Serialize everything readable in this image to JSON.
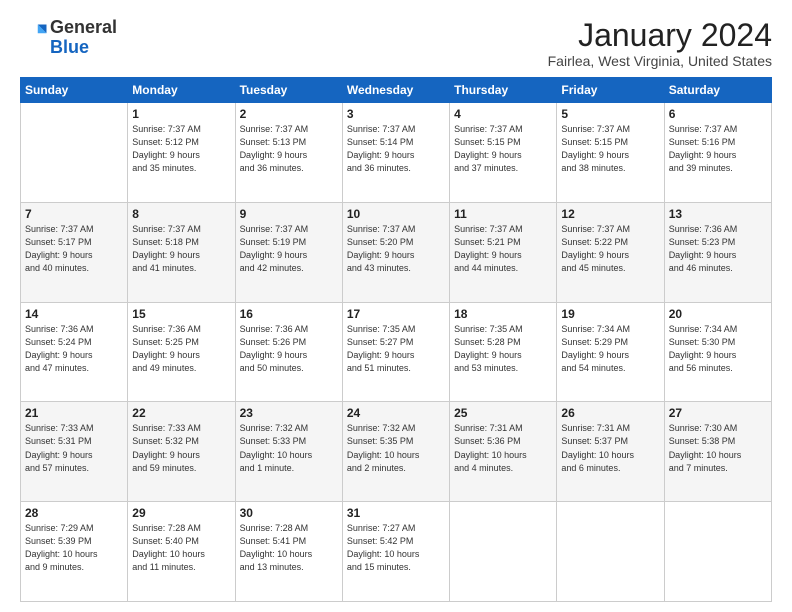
{
  "header": {
    "logo_general": "General",
    "logo_blue": "Blue",
    "month_title": "January 2024",
    "location": "Fairlea, West Virginia, United States"
  },
  "days_of_week": [
    "Sunday",
    "Monday",
    "Tuesday",
    "Wednesday",
    "Thursday",
    "Friday",
    "Saturday"
  ],
  "weeks": [
    [
      {
        "day": "",
        "info": ""
      },
      {
        "day": "1",
        "info": "Sunrise: 7:37 AM\nSunset: 5:12 PM\nDaylight: 9 hours\nand 35 minutes."
      },
      {
        "day": "2",
        "info": "Sunrise: 7:37 AM\nSunset: 5:13 PM\nDaylight: 9 hours\nand 36 minutes."
      },
      {
        "day": "3",
        "info": "Sunrise: 7:37 AM\nSunset: 5:14 PM\nDaylight: 9 hours\nand 36 minutes."
      },
      {
        "day": "4",
        "info": "Sunrise: 7:37 AM\nSunset: 5:15 PM\nDaylight: 9 hours\nand 37 minutes."
      },
      {
        "day": "5",
        "info": "Sunrise: 7:37 AM\nSunset: 5:15 PM\nDaylight: 9 hours\nand 38 minutes."
      },
      {
        "day": "6",
        "info": "Sunrise: 7:37 AM\nSunset: 5:16 PM\nDaylight: 9 hours\nand 39 minutes."
      }
    ],
    [
      {
        "day": "7",
        "info": "Sunrise: 7:37 AM\nSunset: 5:17 PM\nDaylight: 9 hours\nand 40 minutes."
      },
      {
        "day": "8",
        "info": "Sunrise: 7:37 AM\nSunset: 5:18 PM\nDaylight: 9 hours\nand 41 minutes."
      },
      {
        "day": "9",
        "info": "Sunrise: 7:37 AM\nSunset: 5:19 PM\nDaylight: 9 hours\nand 42 minutes."
      },
      {
        "day": "10",
        "info": "Sunrise: 7:37 AM\nSunset: 5:20 PM\nDaylight: 9 hours\nand 43 minutes."
      },
      {
        "day": "11",
        "info": "Sunrise: 7:37 AM\nSunset: 5:21 PM\nDaylight: 9 hours\nand 44 minutes."
      },
      {
        "day": "12",
        "info": "Sunrise: 7:37 AM\nSunset: 5:22 PM\nDaylight: 9 hours\nand 45 minutes."
      },
      {
        "day": "13",
        "info": "Sunrise: 7:36 AM\nSunset: 5:23 PM\nDaylight: 9 hours\nand 46 minutes."
      }
    ],
    [
      {
        "day": "14",
        "info": "Sunrise: 7:36 AM\nSunset: 5:24 PM\nDaylight: 9 hours\nand 47 minutes."
      },
      {
        "day": "15",
        "info": "Sunrise: 7:36 AM\nSunset: 5:25 PM\nDaylight: 9 hours\nand 49 minutes."
      },
      {
        "day": "16",
        "info": "Sunrise: 7:36 AM\nSunset: 5:26 PM\nDaylight: 9 hours\nand 50 minutes."
      },
      {
        "day": "17",
        "info": "Sunrise: 7:35 AM\nSunset: 5:27 PM\nDaylight: 9 hours\nand 51 minutes."
      },
      {
        "day": "18",
        "info": "Sunrise: 7:35 AM\nSunset: 5:28 PM\nDaylight: 9 hours\nand 53 minutes."
      },
      {
        "day": "19",
        "info": "Sunrise: 7:34 AM\nSunset: 5:29 PM\nDaylight: 9 hours\nand 54 minutes."
      },
      {
        "day": "20",
        "info": "Sunrise: 7:34 AM\nSunset: 5:30 PM\nDaylight: 9 hours\nand 56 minutes."
      }
    ],
    [
      {
        "day": "21",
        "info": "Sunrise: 7:33 AM\nSunset: 5:31 PM\nDaylight: 9 hours\nand 57 minutes."
      },
      {
        "day": "22",
        "info": "Sunrise: 7:33 AM\nSunset: 5:32 PM\nDaylight: 9 hours\nand 59 minutes."
      },
      {
        "day": "23",
        "info": "Sunrise: 7:32 AM\nSunset: 5:33 PM\nDaylight: 10 hours\nand 1 minute."
      },
      {
        "day": "24",
        "info": "Sunrise: 7:32 AM\nSunset: 5:35 PM\nDaylight: 10 hours\nand 2 minutes."
      },
      {
        "day": "25",
        "info": "Sunrise: 7:31 AM\nSunset: 5:36 PM\nDaylight: 10 hours\nand 4 minutes."
      },
      {
        "day": "26",
        "info": "Sunrise: 7:31 AM\nSunset: 5:37 PM\nDaylight: 10 hours\nand 6 minutes."
      },
      {
        "day": "27",
        "info": "Sunrise: 7:30 AM\nSunset: 5:38 PM\nDaylight: 10 hours\nand 7 minutes."
      }
    ],
    [
      {
        "day": "28",
        "info": "Sunrise: 7:29 AM\nSunset: 5:39 PM\nDaylight: 10 hours\nand 9 minutes."
      },
      {
        "day": "29",
        "info": "Sunrise: 7:28 AM\nSunset: 5:40 PM\nDaylight: 10 hours\nand 11 minutes."
      },
      {
        "day": "30",
        "info": "Sunrise: 7:28 AM\nSunset: 5:41 PM\nDaylight: 10 hours\nand 13 minutes."
      },
      {
        "day": "31",
        "info": "Sunrise: 7:27 AM\nSunset: 5:42 PM\nDaylight: 10 hours\nand 15 minutes."
      },
      {
        "day": "",
        "info": ""
      },
      {
        "day": "",
        "info": ""
      },
      {
        "day": "",
        "info": ""
      }
    ]
  ]
}
